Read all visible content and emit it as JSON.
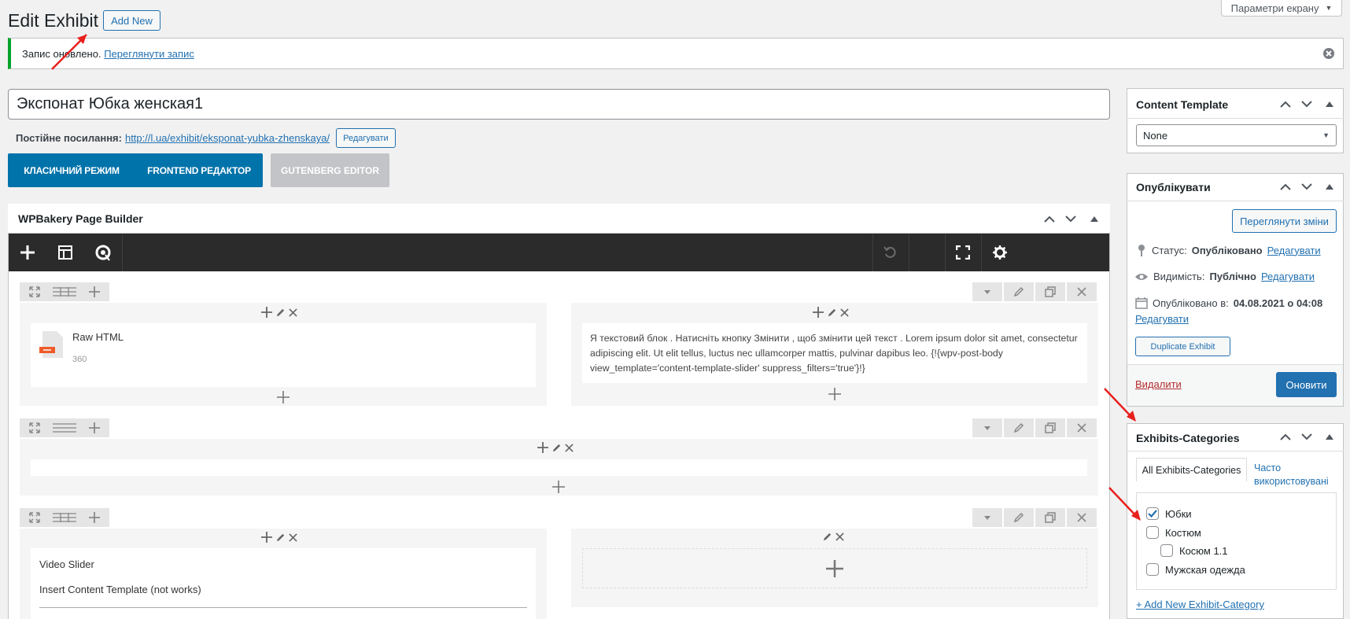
{
  "screen_options": {
    "label": "Параметри екрану"
  },
  "header": {
    "title": "Edit Exhibit",
    "add_new": "Add New"
  },
  "notice": {
    "text": "Запис оновлено.",
    "link": "Переглянути запис"
  },
  "post": {
    "title": "Экспонат Юбка женская1",
    "permalink_label": "Постійне посилання:",
    "permalink_url": "http://l.ua/exhibit/eksponat-yubka-zhenskaya/",
    "permalink_edit": "Редагувати"
  },
  "modes": {
    "classic": "КЛАСИЧНИЙ РЕЖИМ",
    "frontend": "FRONTEND РЕДАКТОР",
    "gutenberg": "GUTENBERG EDITOR"
  },
  "builder": {
    "title": "WPBakery Page Builder",
    "elements": {
      "raw_html_title": "Raw HTML",
      "raw_html_value": "360",
      "text_block": "Я текстовий блок . Натисніть кнопку Змінити , щоб змінити цей текст . Lorem ipsum dolor sit amet, consectetur adipiscing elit. Ut elit tellus, luctus nec ullamcorper mattis, pulvinar dapibus leo. {!{wpv-post-body view_template='content-template-slider' suppress_filters='true'}!}",
      "video_slider": "Video Slider",
      "insert_template": "Insert Content Template (not works)"
    }
  },
  "sidebar": {
    "content_template": {
      "title": "Content Template",
      "selected": "None"
    },
    "publish": {
      "title": "Опублікувати",
      "preview": "Переглянути зміни",
      "status_label": "Статус:",
      "status_value": "Опубліковано",
      "visibility_label": "Видимість:",
      "visibility_value": "Публічно",
      "published_label": "Опубліковано в:",
      "published_value": "04.08.2021 о 04:08",
      "edit": "Редагувати",
      "duplicate": "Duplicate Exhibit",
      "delete": "Видалити",
      "update": "Оновити"
    },
    "categories": {
      "title": "Exhibits-Categories",
      "tab_all": "All Exhibits-Categories",
      "tab_popular": "Часто використовувані",
      "items": [
        {
          "label": "Юбки",
          "checked": true
        },
        {
          "label": "Костюм",
          "checked": false
        },
        {
          "label": "Косюм 1.1",
          "checked": false
        },
        {
          "label": "Мужская одежда",
          "checked": false
        }
      ],
      "add_new": "+ Add New Exhibit-Category"
    }
  },
  "colors": {
    "accent": "#2271b1",
    "wpb_blue": "#0073aa",
    "toolbar": "#2b2b2b",
    "success": "#00a32a",
    "annotation": "#e8201c"
  }
}
